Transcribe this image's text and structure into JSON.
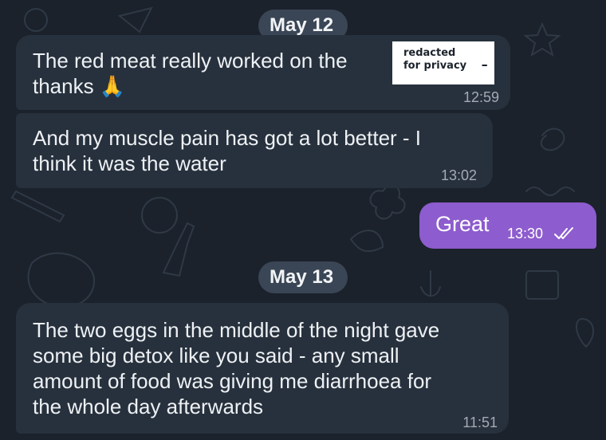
{
  "dates": [
    "May 12",
    "May 13"
  ],
  "messages": [
    {
      "text": "The red meat really worked on the",
      "redaction": "redacted\nfor privacy",
      "dash": "-",
      "text2": "thanks",
      "emoji": "🙏",
      "time": "12:59"
    },
    {
      "text": "And my muscle pain has got a lot better - I\nthink it was the water",
      "time": "13:02"
    },
    {
      "text": "Great",
      "time": "13:30",
      "status_icon": "double-check-icon"
    },
    {
      "text": "The two eggs in the middle of the night gave\nsome big detox like you said - any small\namount of food was giving me diarrhoea for\nthe whole day afterwards",
      "time": "11:51"
    }
  ],
  "colors": {
    "background": "#1b222b",
    "incoming_bubble": "#27313d",
    "outgoing_bubble": "#8d5cce",
    "date_pill": "#3a4655",
    "redaction_box": "#ffffff"
  }
}
